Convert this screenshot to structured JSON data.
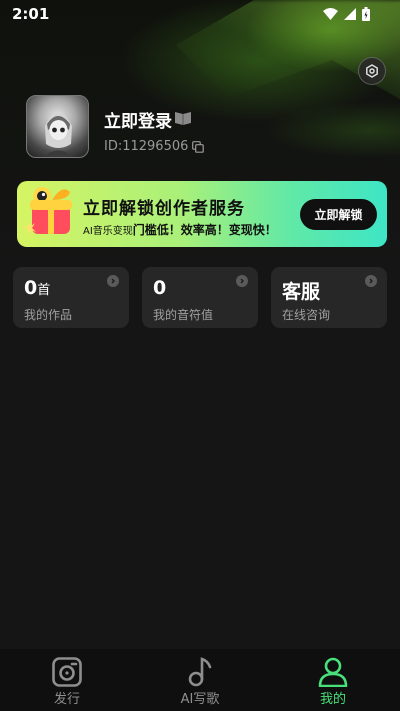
{
  "status_bar": {
    "time": "2:01"
  },
  "profile": {
    "login_title": "立即登录",
    "user_id": "ID:11296506"
  },
  "banner": {
    "title": "立即解锁创作者服务",
    "subtitle_prefix": "AI音乐变现",
    "subtitle_highlight": "门槛低！效率高！变现快！",
    "button_label": "立即解锁"
  },
  "cards": [
    {
      "value": "0",
      "unit": "首",
      "label": "我的作品"
    },
    {
      "value": "0",
      "unit": "",
      "label": "我的音符值"
    },
    {
      "value": "客服",
      "unit": "",
      "label": "在线咨询"
    }
  ],
  "bottom_nav": {
    "items": [
      {
        "label": "发行",
        "icon": "release-icon"
      },
      {
        "label": "AI写歌",
        "icon": "music-note-icon"
      },
      {
        "label": "我的",
        "icon": "user-icon"
      }
    ],
    "active_index": 2
  },
  "colors": {
    "background": "#151515",
    "card": "#272727",
    "accent_green": "#48e07a",
    "banner_start": "#d6f463",
    "banner_end": "#3ee5c6"
  }
}
